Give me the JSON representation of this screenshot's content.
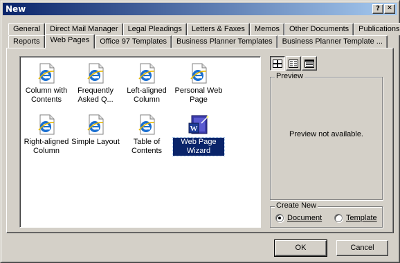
{
  "window": {
    "title": "New"
  },
  "titlebar_buttons": {
    "help": "?",
    "close": "✕"
  },
  "tabs_back": [
    "General",
    "Direct Mail Manager",
    "Legal Pleadings",
    "Letters & Faxes",
    "Memos",
    "Other Documents",
    "Publications"
  ],
  "tabs_front": [
    "Reports",
    "Web Pages",
    "Office 97 Templates",
    "Business Planner Templates",
    "Business Planner Template ..."
  ],
  "active_tab": "Web Pages",
  "templates": [
    {
      "label": "Column with Contents",
      "icon": "ie-document-icon"
    },
    {
      "label": "Frequently Asked Q...",
      "icon": "ie-document-icon"
    },
    {
      "label": "Left-aligned Column",
      "icon": "ie-document-icon"
    },
    {
      "label": "Personal Web Page",
      "icon": "ie-document-icon"
    },
    {
      "label": "Right-aligned Column",
      "icon": "ie-document-icon"
    },
    {
      "label": "Simple Layout",
      "icon": "ie-document-icon"
    },
    {
      "label": "Table of Contents",
      "icon": "ie-document-icon"
    },
    {
      "label": "Web Page Wizard",
      "icon": "word-wizard-icon",
      "selected": true
    }
  ],
  "view_buttons": [
    "large-icons-view-icon",
    "list-view-icon",
    "details-view-icon"
  ],
  "preview": {
    "label": "Preview",
    "message": "Preview not available."
  },
  "create_new": {
    "label": "Create New",
    "options": [
      {
        "label": "Document",
        "checked": true
      },
      {
        "label": "Template",
        "checked": false
      }
    ]
  },
  "buttons": {
    "ok": "OK",
    "cancel": "Cancel"
  },
  "colors": {
    "titlebar_start": "#0a246a",
    "titlebar_end": "#a6caf0",
    "face": "#d4d0c8",
    "selection": "#0a246a"
  }
}
